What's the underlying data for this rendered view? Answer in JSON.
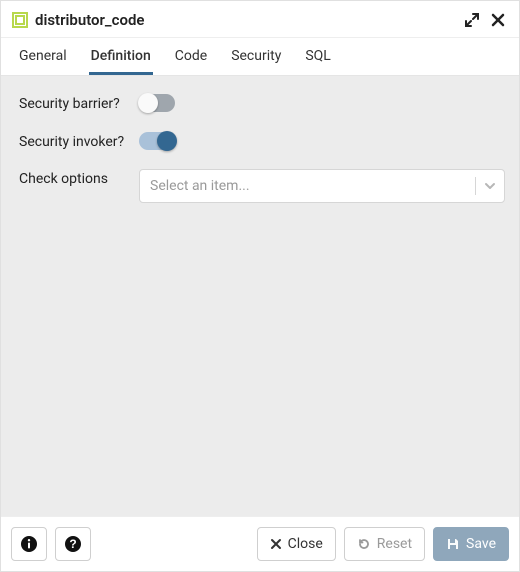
{
  "header": {
    "title": "distributor_code"
  },
  "tabs": [
    {
      "label": "General",
      "active": false
    },
    {
      "label": "Definition",
      "active": true
    },
    {
      "label": "Code",
      "active": false
    },
    {
      "label": "Security",
      "active": false
    },
    {
      "label": "SQL",
      "active": false
    }
  ],
  "fields": {
    "security_barrier": {
      "label": "Security barrier?",
      "value": false
    },
    "security_invoker": {
      "label": "Security invoker?",
      "value": true
    },
    "check_options": {
      "label": "Check options",
      "placeholder": "Select an item..."
    }
  },
  "footer": {
    "close_label": "Close",
    "reset_label": "Reset",
    "save_label": "Save"
  }
}
